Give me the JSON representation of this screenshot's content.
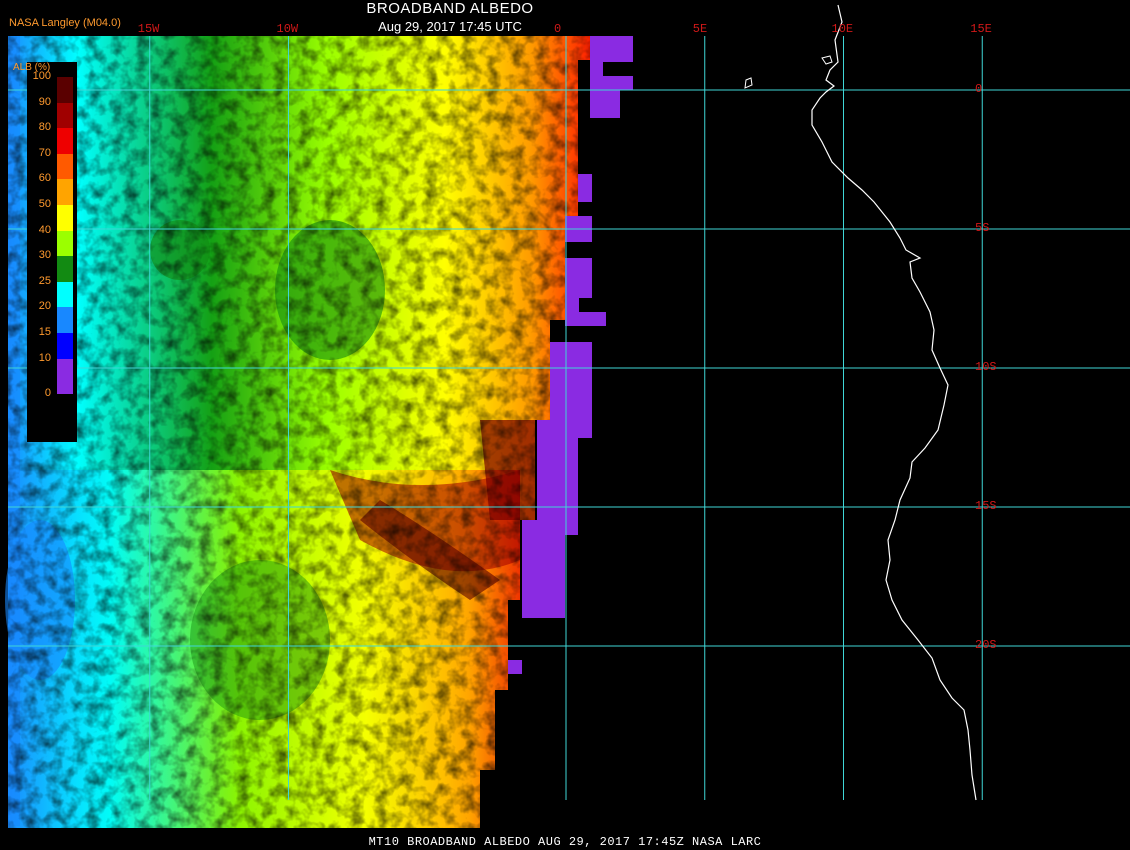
{
  "header": {
    "title": "BROADBAND ALBEDO",
    "subtitle": "Aug 29, 2017 17:45 UTC",
    "org": "NASA Langley (M04.0)"
  },
  "footer": {
    "text": "MT10  BROADBAND ALBEDO   AUG 29, 2017 17:45Z   NASA LARC"
  },
  "grid": {
    "color": "#3fd6d6",
    "longitudes": [
      {
        "label": "15W",
        "value": -15
      },
      {
        "label": "10W",
        "value": -10
      },
      {
        "label": "0",
        "value": 0
      },
      {
        "label": "5E",
        "value": 5
      },
      {
        "label": "10E",
        "value": 10
      },
      {
        "label": "15E",
        "value": 15
      }
    ],
    "latitudes": [
      {
        "label": "0",
        "value": 0
      },
      {
        "label": "5S",
        "value": -5
      },
      {
        "label": "10S",
        "value": -10
      },
      {
        "label": "15S",
        "value": -15
      },
      {
        "label": "20S",
        "value": -20
      }
    ],
    "label_color": "#d01818"
  },
  "legend": {
    "title": "ALB (%)",
    "ticks": [
      "100",
      "90",
      "80",
      "70",
      "60",
      "50",
      "40",
      "30",
      "25",
      "20",
      "15",
      "10",
      "0"
    ],
    "colors": [
      "#5a0000",
      "#a00000",
      "#ee0000",
      "#ff5a00",
      "#ffa400",
      "#ffff00",
      "#9bff00",
      "#128a12",
      "#00ffff",
      "#1888ff",
      "#0000ff",
      "#8a2be2"
    ]
  },
  "coastline_color": "#ffffff"
}
